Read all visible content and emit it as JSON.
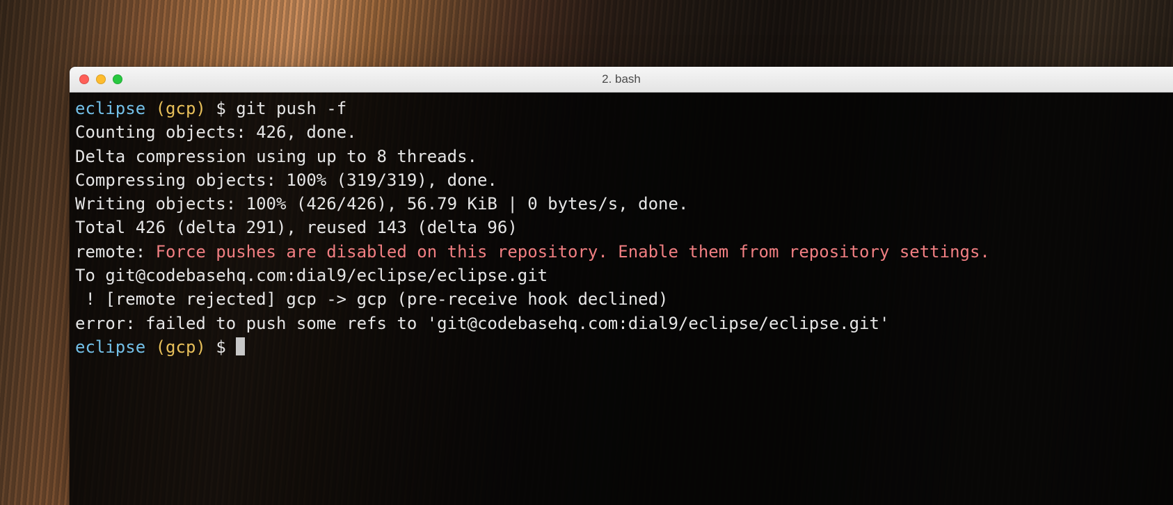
{
  "window": {
    "title": "2. bash"
  },
  "prompt1": {
    "path": "eclipse",
    "branch": "(gcp)",
    "symbol": "$",
    "command": "git push -f"
  },
  "output": {
    "l1": "Counting objects: 426, done.",
    "l2": "Delta compression using up to 8 threads.",
    "l3": "Compressing objects: 100% (319/319), done.",
    "l4": "Writing objects: 100% (426/426), 56.79 KiB | 0 bytes/s, done.",
    "l5": "Total 426 (delta 291), reused 143 (delta 96)",
    "remote_label": "remote: ",
    "remote_msg": "Force pushes are disabled on this repository. Enable them from repository settings.",
    "l7": "To git@codebasehq.com:dial9/eclipse/eclipse.git",
    "l8": " ! [remote rejected] gcp -> gcp (pre-receive hook declined)",
    "l9": "error: failed to push some refs to 'git@codebasehq.com:dial9/eclipse/eclipse.git'"
  },
  "prompt2": {
    "path": "eclipse",
    "branch": "(gcp)",
    "symbol": "$"
  },
  "colors": {
    "path": "#73c0e8",
    "branch": "#e8c05a",
    "error": "#f17f82",
    "text": "#e6e6e6",
    "term_bg": "rgba(4,4,4,0.90)"
  }
}
